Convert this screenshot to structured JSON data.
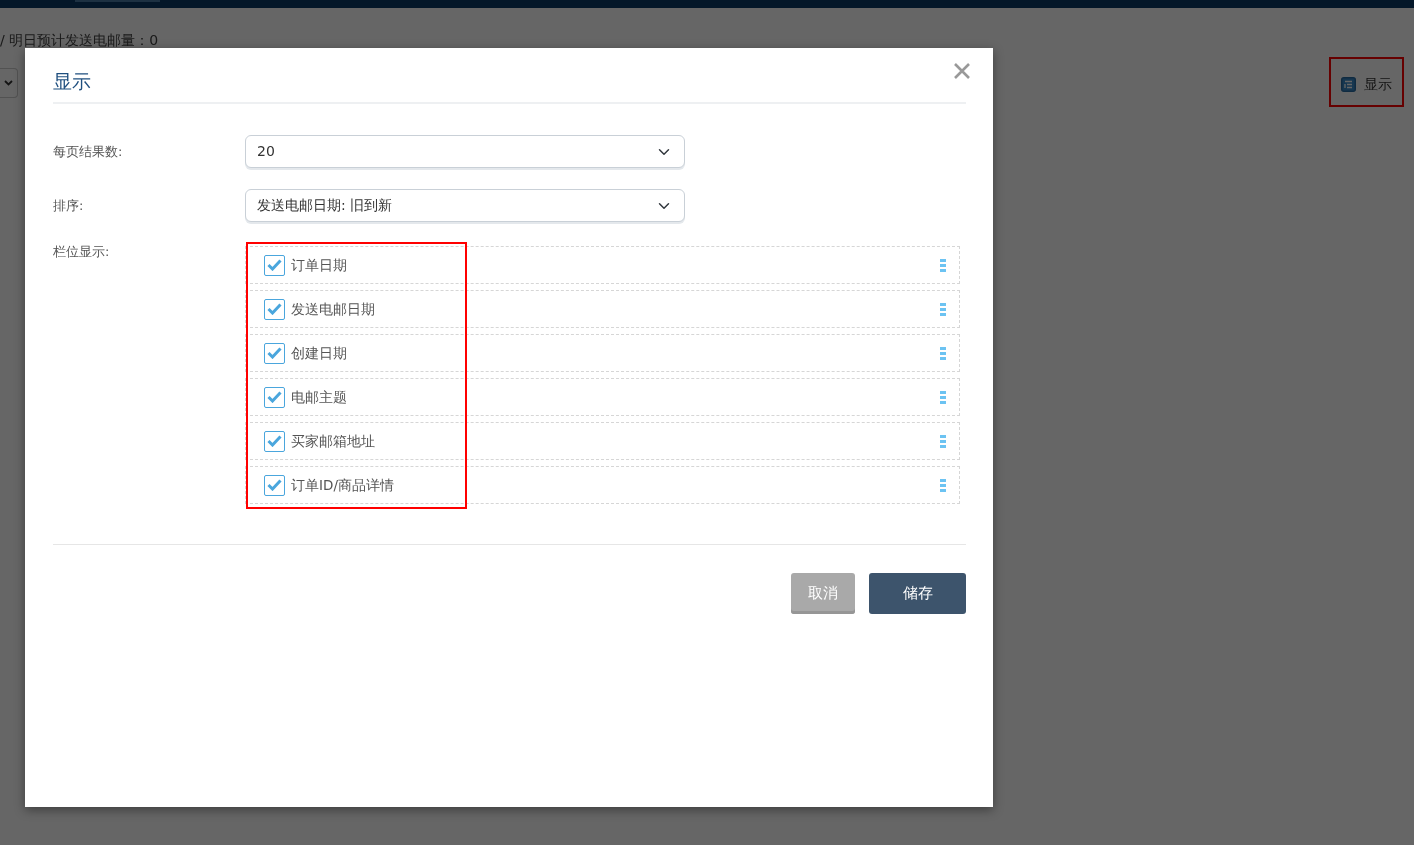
{
  "background": {
    "summary_text": "/ 明日预计发送电邮量：0",
    "display_button": {
      "label": "显示"
    }
  },
  "dialog": {
    "title": "显示",
    "fields": [
      {
        "label": "每页结果数:",
        "value": "20"
      },
      {
        "label": "排序:",
        "value": "发送电邮日期: 旧到新"
      }
    ],
    "columns_label": "栏位显示:",
    "columns": [
      {
        "label": "订单日期",
        "checked": true
      },
      {
        "label": "发送电邮日期",
        "checked": true
      },
      {
        "label": "创建日期",
        "checked": true
      },
      {
        "label": "电邮主题",
        "checked": true
      },
      {
        "label": "买家邮箱地址",
        "checked": true
      },
      {
        "label": "订单ID/商品详情",
        "checked": true
      }
    ],
    "buttons": [
      {
        "label": "取消",
        "kind": "secondary"
      },
      {
        "label": "储存",
        "kind": "primary"
      }
    ]
  }
}
